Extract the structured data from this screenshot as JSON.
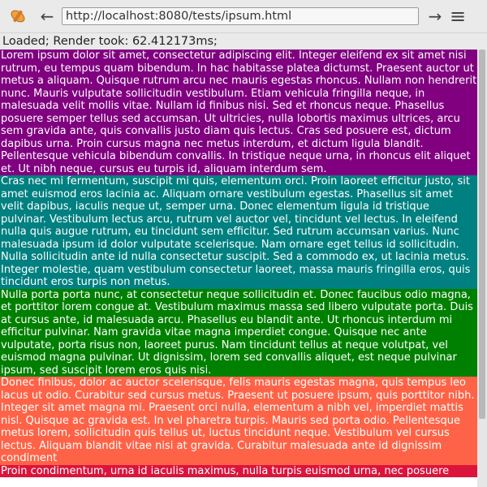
{
  "toolbar": {
    "url": "http://localhost:8080/tests/ipsum.html",
    "icons": {
      "logo": "paintbrush-logo-icon",
      "back": "arrow-left-icon",
      "go": "arrow-right-icon",
      "menu": "hamburger-menu-icon"
    },
    "back_glyph": "←",
    "go_glyph": "→",
    "menu_glyph": "≡"
  },
  "status": {
    "text": "Loaded; Render took: 62.412173ms;"
  },
  "paragraphs": [
    {
      "color": "#800080",
      "text": "Lorem ipsum dolor sit amet, consectetur adipiscing elit. Integer eleifend ex sit amet nisi rutrum, eu tempus quam bibendum. In hac habitasse platea dictumst. Praesent auctor ut metus a aliquam. Quisque rutrum arcu nec mauris egestas rhoncus. Nullam non hendrerit nunc. Mauris vulputate sollicitudin vestibulum. Etiam vehicula fringilla neque, in malesuada velit mollis vitae. Nullam id finibus nisi. Sed et rhoncus neque. Phasellus posuere semper tellus sed accumsan. Ut ultricies, nulla lobortis maximus ultrices, arcu sem gravida ante, quis convallis justo diam quis lectus. Cras sed posuere est, dictum dapibus urna. Proin cursus magna nec metus interdum, et dictum ligula blandit. Pellentesque vehicula bibendum convallis. In tristique neque urna, in rhoncus elit aliquet et. Ut nibh neque, cursus eu turpis id, aliquam interdum sem."
    },
    {
      "color": "#008080",
      "text": "Cras nec mi fermentum, suscipit mi quis, elementum orci. Proin laoreet efficitur justo, sit amet euismod eros lacinia ac. Aliquam ornare vestibulum egestas. Phasellus sit amet velit dapibus, iaculis neque ut, semper urna. Donec elementum ligula id tristique pulvinar. Vestibulum lectus arcu, rutrum vel auctor vel, tincidunt vel lectus. In eleifend nulla quis augue rutrum, eu tincidunt sem efficitur. Sed rutrum accumsan varius. Nunc malesuada ipsum id dolor vulputate scelerisque. Nam ornare eget tellus id sollicitudin. Nulla sollicitudin ante id nulla consectetur suscipit. Sed a commodo ex, ut lacinia metus. Integer molestie, quam vestibulum consectetur laoreet, massa mauris fringilla eros, quis tincidunt eros turpis non metus."
    },
    {
      "color": "#008000",
      "text": "Nulla porta porta nunc, at consectetur neque sollicitudin et. Donec faucibus odio magna, et porttitor lorem congue at. Vestibulum maximus massa sed libero vulputate porta. Duis at cursus ante, id malesuada arcu. Phasellus eu blandit ante. Ut rhoncus interdum mi efficitur pulvinar. Nam gravida vitae magna imperdiet congue. Quisque nec ante vulputate, porta risus non, laoreet purus. Nam tincidunt tellus at neque volutpat, vel euismod magna pulvinar. Ut dignissim, lorem sed convallis aliquet, est neque pulvinar ipsum, sed suscipit lorem eros quis nisi."
    },
    {
      "color": "#ff6347",
      "text": "Donec finibus, dolor ac auctor scelerisque, felis mauris egestas magna, quis tempus leo lacus ut odio. Curabitur sed cursus metus. Praesent ut posuere ipsum, quis porttitor nibh. Integer sit amet magna mi. Praesent orci nulla, elementum a nibh vel, imperdiet mattis nisl. Quisque ac gravida est. In vel pharetra turpis. Mauris sed porta odio. Pellentesque metus lorem, sollicitudin quis tellus ut, luctus tincidunt neque. Vestibulum vel cursus lectus. Aliquam blandit vitae nisi at gravida. Curabitur malesuada ante id dignissim condiment"
    },
    {
      "color": "#dc143c",
      "text": "Proin condimentum, urna id iaculis maximus, nulla turpis euismod urna, nec posuere"
    }
  ]
}
